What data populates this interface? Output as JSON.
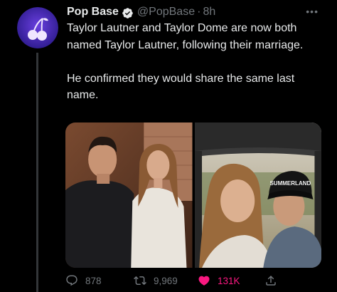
{
  "author": {
    "display_name": "Pop Base",
    "handle": "@PopBase",
    "separator": "·",
    "timestamp": "8h"
  },
  "tweet": {
    "paragraph_1": "Taylor Lautner and Taylor Dome are now both named Taylor Lautner, following their marriage.",
    "paragraph_2": "He confirmed they would share the same last name."
  },
  "media": {
    "image_2_cap_text": "SUMMERLAND"
  },
  "actions": {
    "reply_count": "878",
    "retweet_count": "9,969",
    "like_count": "131K"
  },
  "colors": {
    "background": "#000000",
    "text_primary": "#e7e9ea",
    "text_secondary": "#71767b",
    "verified": "#1d9bf0",
    "like_active": "#f91880",
    "avatar_bg": "#4a2fb8"
  },
  "icons": [
    "verified-icon",
    "more-icon",
    "reply-icon",
    "retweet-icon",
    "heart-icon",
    "share-icon",
    "cherry-icon"
  ]
}
